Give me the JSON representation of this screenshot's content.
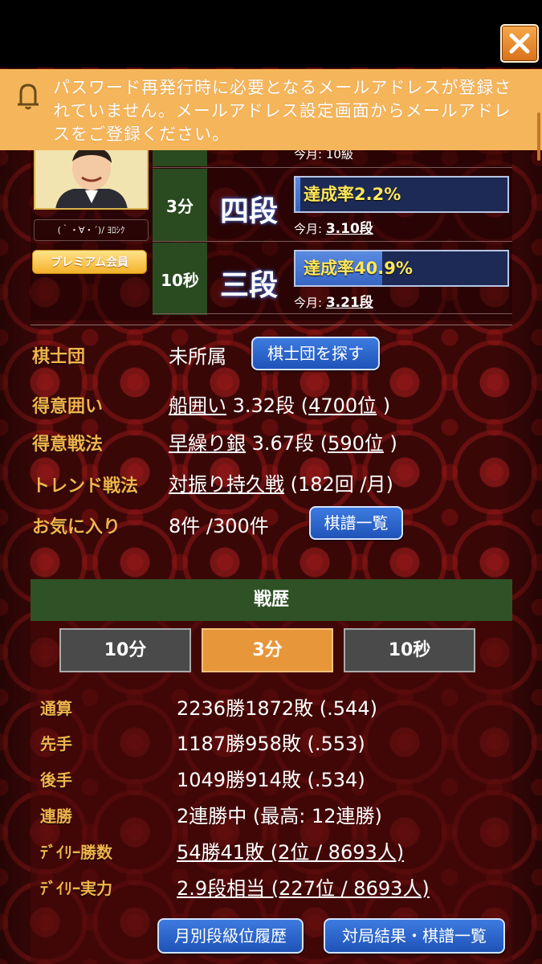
{
  "notice": {
    "text": "パスワード再発行時に必要となるメールアドレスが登録されていません。メールアドレス設定画面からメールアドレスをご登録ください。"
  },
  "profile": {
    "nickname": "(｀・∀・´)/ ﾖﾛｼｸ",
    "membership": "プレミアム会員",
    "partial_month": "今月: 10級",
    "ranks": [
      {
        "mode": "3分",
        "rank": "四段",
        "rate_text": "達成率2.2%",
        "rate": 0.022,
        "month_label": "今月: ",
        "month_value": "3.10段"
      },
      {
        "mode": "10秒",
        "rank": "三段",
        "rate_text": "達成率40.9%",
        "rate": 0.409,
        "month_label": "今月: ",
        "month_value": "3.21段"
      }
    ]
  },
  "info": {
    "group_label": "棋士団",
    "group_value": "未所属",
    "group_button": "棋士団を探す",
    "castle_label": "得意囲い",
    "castle_name": "船囲い",
    "castle_rest": " 3.32段 (",
    "castle_rank": "4700位",
    "castle_end": " )",
    "strategy_label": "得意戦法",
    "strategy_name": "早繰り銀",
    "strategy_rest": " 3.67段 (",
    "strategy_rank": "590位",
    "strategy_end": " )",
    "trend_label": "トレンド戦法",
    "trend_name": "対振り持久戦",
    "trend_rest": " (182回 /月)",
    "fav_label": "お気に入り",
    "fav_value": "8件 /300件",
    "fav_button": "棋譜一覧"
  },
  "record": {
    "title": "戦歴",
    "tabs": [
      "10分",
      "3分",
      "10秒"
    ],
    "active_tab": "3分",
    "rows": [
      {
        "label": "通算",
        "value": "2236勝1872敗 (.544)"
      },
      {
        "label": "先手",
        "value": "1187勝958敗 (.553)"
      },
      {
        "label": "後手",
        "value": "1049勝914敗 (.534)"
      },
      {
        "label": "連勝",
        "value": "2連勝中 (最高: 12連勝)"
      },
      {
        "label": "ﾃﾞｲﾘｰ勝数",
        "value": "54勝41敗 (2位 / 8693人)"
      },
      {
        "label": "ﾃﾞｲﾘｰ実力",
        "value": "2.9段相当 (227位 / 8693人)"
      }
    ],
    "monthly_button": "月別段級位履歴",
    "games_button": "対局結果・棋譜一覧"
  },
  "colors": {
    "banner": "#f5b55a",
    "label_gold": "#f0b34c",
    "rank_label_green": "#2a4a20",
    "tab_active": "#e8963a",
    "button_blue": "#2f66cc"
  },
  "icons": {
    "close": "close-icon",
    "bell": "bell-icon"
  }
}
